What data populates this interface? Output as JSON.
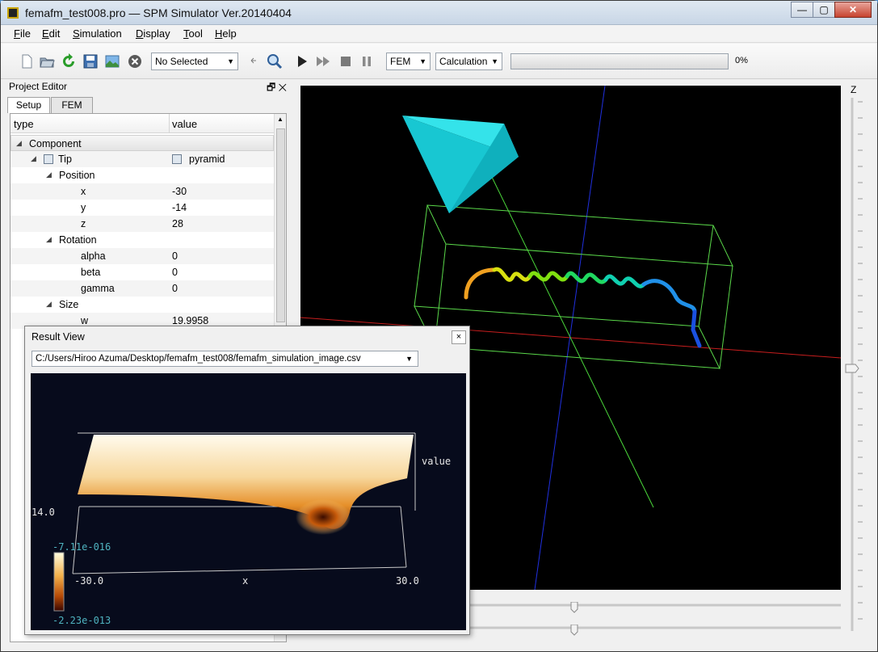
{
  "window": {
    "title": "femafm_test008.pro — SPM Simulator Ver.20140404",
    "controls": {
      "minimize": "—",
      "maximize": "▢",
      "close": "✕"
    }
  },
  "menu": [
    {
      "label": "File",
      "accel": "F",
      "rest": "ile"
    },
    {
      "label": "Edit",
      "accel": "E",
      "rest": "dit"
    },
    {
      "label": "Simulation",
      "accel": "S",
      "rest": "imulation"
    },
    {
      "label": "Display",
      "accel": "D",
      "rest": "isplay"
    },
    {
      "label": "Tool",
      "accel": "T",
      "rest": "ool"
    },
    {
      "label": "Help",
      "accel": "H",
      "rest": "elp"
    }
  ],
  "toolbar": {
    "selection_combo": "No Selected",
    "mode_combo": "FEM",
    "calc_combo": "Calculation",
    "progress_value": 0,
    "progress_text": "0%",
    "icons": [
      "new-file-icon",
      "open-folder-icon",
      "refresh-icon",
      "save-icon",
      "image-icon",
      "stop-circle-icon",
      "small-arrow-icon",
      "zoom-icon",
      "play-icon",
      "fast-forward-icon",
      "stop-icon",
      "pause-icon"
    ]
  },
  "project_editor": {
    "title": "Project Editor",
    "title_buttons": "🗗 ✕",
    "tabs": [
      "Setup",
      "FEM"
    ],
    "columns": [
      "type",
      "value"
    ],
    "rows": [
      {
        "indent": 0,
        "label": "Component",
        "value": "",
        "toggle": true,
        "group": true
      },
      {
        "indent": 1,
        "label": "Tip",
        "value": "pyramid",
        "toggle": true,
        "icon": true
      },
      {
        "indent": 2,
        "label": "Position",
        "value": "",
        "toggle": true
      },
      {
        "indent": 3,
        "label": "x",
        "value": "-30"
      },
      {
        "indent": 3,
        "label": "y",
        "value": "-14"
      },
      {
        "indent": 3,
        "label": "z",
        "value": "28"
      },
      {
        "indent": 2,
        "label": "Rotation",
        "value": "",
        "toggle": true
      },
      {
        "indent": 3,
        "label": "alpha",
        "value": "0"
      },
      {
        "indent": 3,
        "label": "beta",
        "value": "0"
      },
      {
        "indent": 3,
        "label": "gamma",
        "value": "0"
      },
      {
        "indent": 2,
        "label": "Size",
        "value": "",
        "toggle": true
      },
      {
        "indent": 3,
        "label": "w",
        "value": "19.9958"
      }
    ]
  },
  "view3d": {
    "z_label": "Z"
  },
  "result_view": {
    "title": "Result View",
    "close": "×",
    "file_path": "C:/Users/Hiroo Azuma/Desktop/femafm_test008/femafm_simulation_image.csv",
    "plot": {
      "value_label": "value",
      "y_tick": "14.0",
      "colorbar_max": "-7.11e-016",
      "colorbar_min": "-2.23e-013",
      "x_min": "-30.0",
      "x_max": "30.0",
      "x_label": "x"
    }
  }
}
